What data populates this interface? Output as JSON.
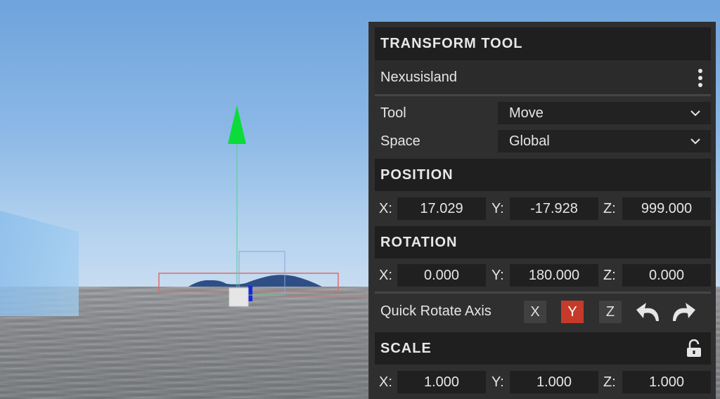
{
  "panel": {
    "title": "TRANSFORM TOOL",
    "object_name": "Nexusisland",
    "menu_icon": "vertical-ellipsis-icon",
    "tool": {
      "label": "Tool",
      "value": "Move"
    },
    "space": {
      "label": "Space",
      "value": "Global"
    },
    "position": {
      "title": "POSITION",
      "x_label": "X:",
      "x": "17.029",
      "y_label": "Y:",
      "y": "-17.928",
      "z_label": "Z:",
      "z": "999.000"
    },
    "rotation": {
      "title": "ROTATION",
      "x_label": "X:",
      "x": "0.000",
      "y_label": "Y:",
      "y": "180.000",
      "z_label": "Z:",
      "z": "0.000"
    },
    "quick_rotate": {
      "label": "Quick Rotate Axis",
      "axes": [
        "X",
        "Y",
        "Z"
      ],
      "selected": "Y",
      "rotate_left_icon": "rotate-counterclockwise-icon",
      "rotate_right_icon": "rotate-clockwise-icon"
    },
    "scale": {
      "title": "SCALE",
      "lock_icon": "unlocked-padlock-icon",
      "x_label": "X:",
      "x": "1.000",
      "y_label": "Y:",
      "y": "1.000",
      "z_label": "Z:",
      "z": "1.000"
    }
  },
  "colors": {
    "accent_active": "#c63a2a",
    "panel_bg": "#2f2f2f",
    "header_bg": "#1f1f1f",
    "gizmo_y_axis": "#00e040",
    "gizmo_z_axis": "#1020e0",
    "bounding_box": "#e06060"
  }
}
